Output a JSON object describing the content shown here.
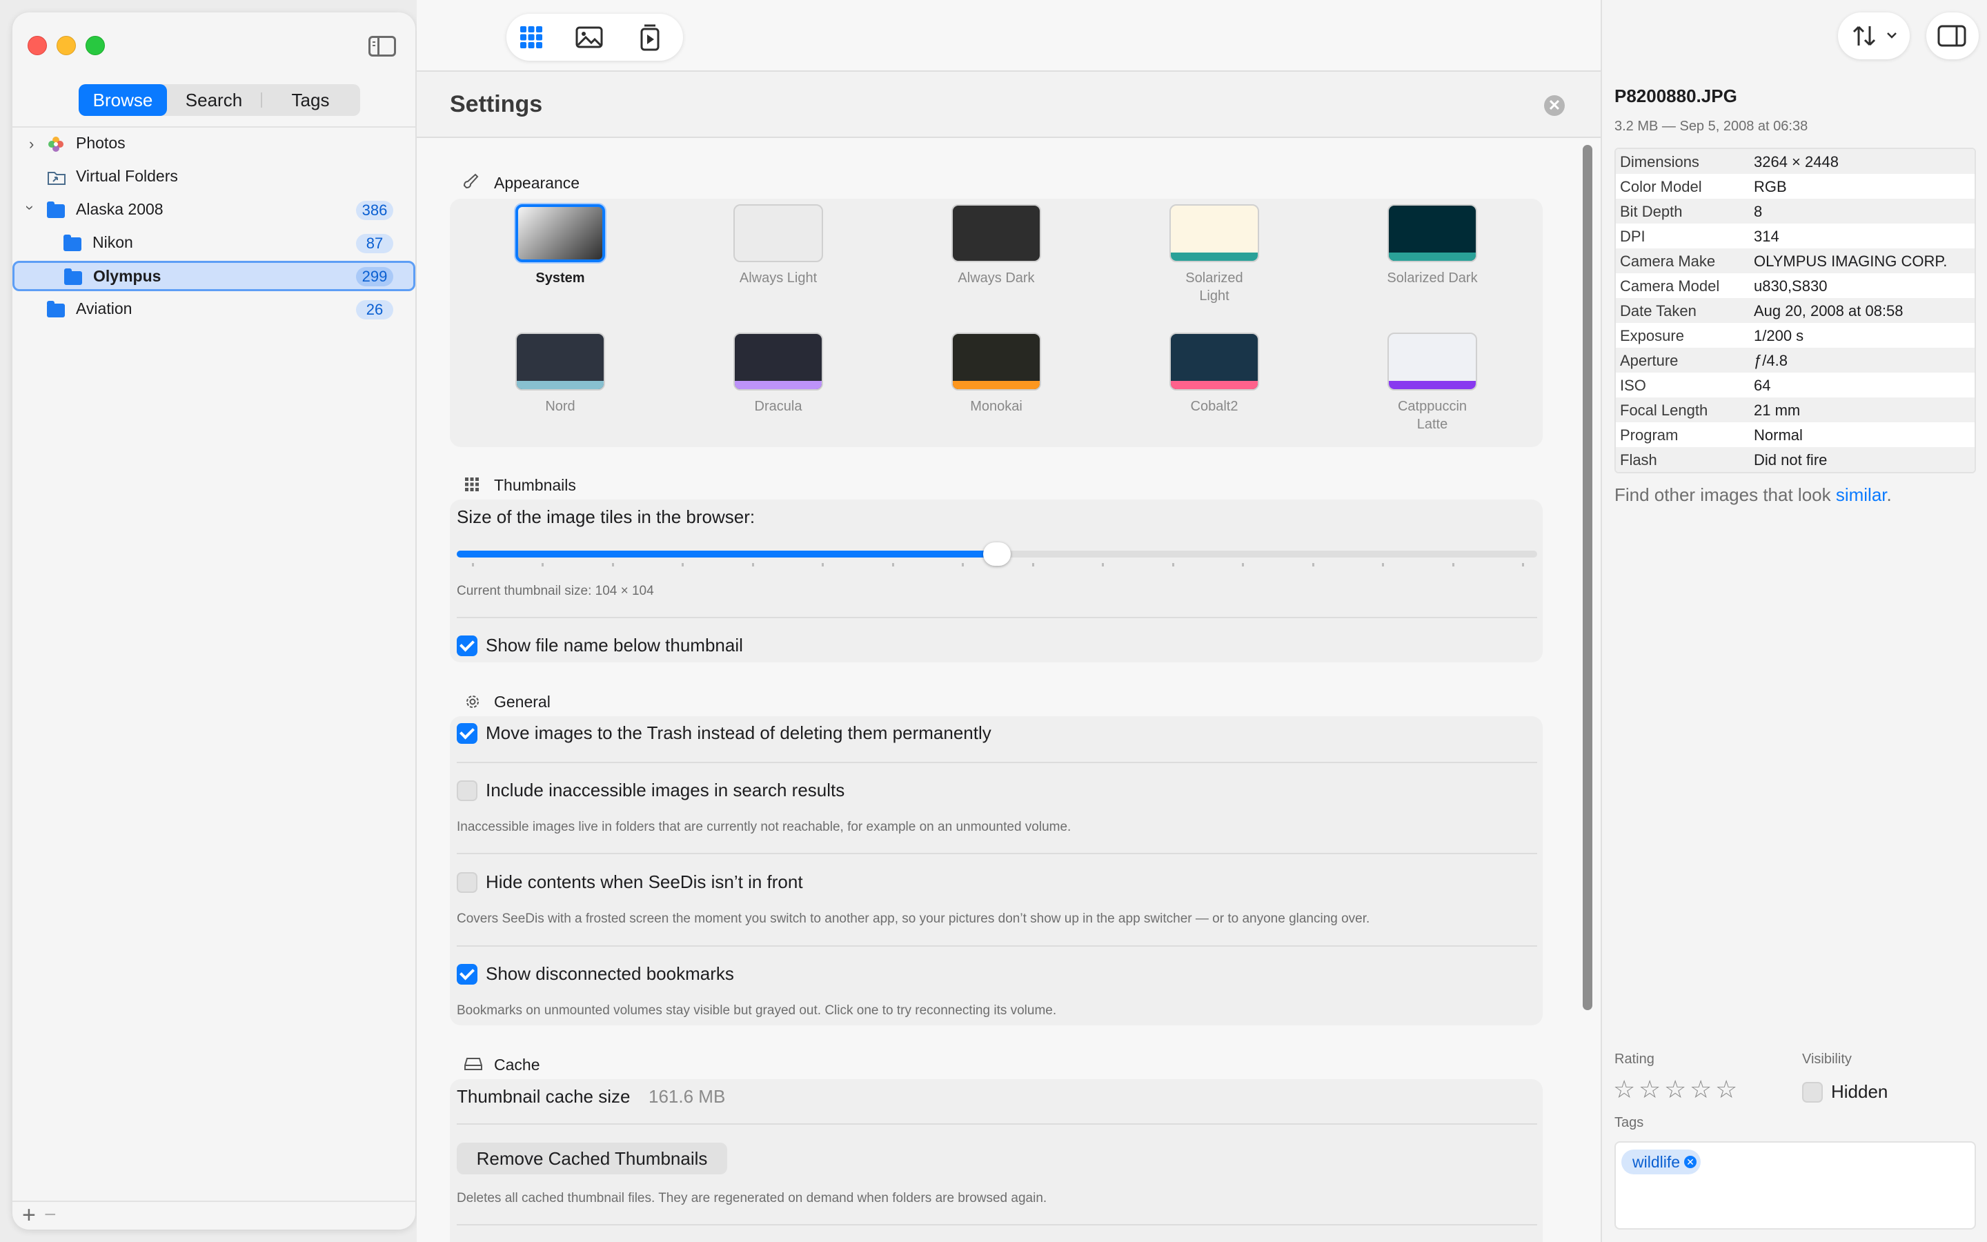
{
  "sidebar": {
    "tabs": [
      "Browse",
      "Search",
      "Tags"
    ],
    "active_tab": 0,
    "tree": [
      {
        "label": "Photos",
        "count": "",
        "expanded": false,
        "has_children": true,
        "level": 0,
        "icon": "photos-icon"
      },
      {
        "label": "Virtual Folders",
        "count": "",
        "has_children": false,
        "level": 0,
        "icon": "virtual-folder-icon"
      },
      {
        "label": "Alaska 2008",
        "count": "386",
        "expanded": true,
        "has_children": true,
        "level": 0,
        "icon": "folder-icon"
      },
      {
        "label": "Nikon",
        "count": "87",
        "has_children": false,
        "level": 1,
        "icon": "folder-icon"
      },
      {
        "label": "Olympus",
        "count": "299",
        "has_children": false,
        "level": 1,
        "icon": "folder-icon",
        "selected": true
      },
      {
        "label": "Aviation",
        "count": "26",
        "has_children": false,
        "level": 0,
        "icon": "folder-icon"
      }
    ],
    "footer": {
      "add": "+",
      "remove": "−"
    }
  },
  "toolbar": {
    "view_modes": [
      "grid-icon",
      "image-icon",
      "slideshow-icon"
    ],
    "active_view": 0
  },
  "settings": {
    "title": "Settings",
    "close_glyph": "✕",
    "appearance": {
      "title": "Appearance",
      "themes": [
        {
          "label": "System",
          "bg": "#8a8a8a",
          "strip": "",
          "selected": true
        },
        {
          "label": "Always Light",
          "bg": "#ebebeb",
          "strip": ""
        },
        {
          "label": "Always Dark",
          "bg": "#2e2e2e",
          "strip": ""
        },
        {
          "label": "Solarized Light",
          "bg": "#fdf6e3",
          "strip": "#2aa198"
        },
        {
          "label": "Solarized Dark",
          "bg": "#002b36",
          "strip": "#2aa198"
        },
        {
          "label": "Nord",
          "bg": "#2e3440",
          "strip": "#88c0d0"
        },
        {
          "label": "Dracula",
          "bg": "#282a36",
          "strip": "#bd93f9"
        },
        {
          "label": "Monokai",
          "bg": "#272822",
          "strip": "#fd971f"
        },
        {
          "label": "Cobalt2",
          "bg": "#193549",
          "strip": "#ff628c"
        },
        {
          "label": "Catppuccin Latte",
          "bg": "#eff1f5",
          "strip": "#8839ef"
        }
      ]
    },
    "thumbnails": {
      "title": "Thumbnails",
      "size_label": "Size of the image tiles in the browser:",
      "slider_fraction": 0.5,
      "current_size": "Current thumbnail size: 104 × 104",
      "show_filename": {
        "label": "Show file name below thumbnail",
        "checked": true
      }
    },
    "general": {
      "title": "General",
      "options": [
        {
          "label": "Move images to the Trash instead of deleting them permanently",
          "checked": true,
          "desc": ""
        },
        {
          "label": "Include inaccessible images in search results",
          "checked": false,
          "desc": "Inaccessible images live in folders that are currently not reachable, for example on an unmounted volume."
        },
        {
          "label": "Hide contents when SeeDis isn’t in front",
          "checked": false,
          "desc": "Covers SeeDis with a frosted screen the moment you switch to another app, so your pictures don’t show up in the app switcher — or to anyone glancing over."
        },
        {
          "label": "Show disconnected bookmarks",
          "checked": true,
          "desc": "Bookmarks on unmounted volumes stay visible but grayed out. Click one to try reconnecting its volume."
        }
      ]
    },
    "cache": {
      "title": "Cache",
      "size_label": "Thumbnail cache size",
      "size_value": "161.6 MB",
      "remove_button": "Remove Cached Thumbnails",
      "remove_desc": "Deletes all cached thumbnail files. They are regenerated on demand when folders are browsed again."
    }
  },
  "inspector": {
    "filename": "P8200880.JPG",
    "meta": "3.2 MB — Sep 5, 2008 at 06:38",
    "exif": [
      {
        "k": "Dimensions",
        "v": "3264 × 2448"
      },
      {
        "k": "Color Model",
        "v": "RGB"
      },
      {
        "k": "Bit Depth",
        "v": "8"
      },
      {
        "k": "DPI",
        "v": "314"
      },
      {
        "k": "Camera Make",
        "v": "OLYMPUS IMAGING CORP."
      },
      {
        "k": "Camera Model",
        "v": "u830,S830"
      },
      {
        "k": "Date Taken",
        "v": "Aug 20, 2008 at 08:58"
      },
      {
        "k": "Exposure",
        "v": "1/200 s"
      },
      {
        "k": "Aperture",
        "v": "ƒ/4.8"
      },
      {
        "k": "ISO",
        "v": "64"
      },
      {
        "k": "Focal Length",
        "v": "21 mm"
      },
      {
        "k": "Program",
        "v": "Normal"
      },
      {
        "k": "Flash",
        "v": "Did not fire"
      }
    ],
    "similar_prefix": "Find other images that look ",
    "similar_link": "similar",
    "similar_suffix": ".",
    "rating_label": "Rating",
    "rating_value": 0,
    "rating_max": 5,
    "visibility_label": "Visibility",
    "hidden_label": "Hidden",
    "hidden_checked": false,
    "tags_label": "Tags",
    "tags": [
      "wildlife"
    ]
  },
  "colors": {
    "accent": "#0a7aff"
  }
}
